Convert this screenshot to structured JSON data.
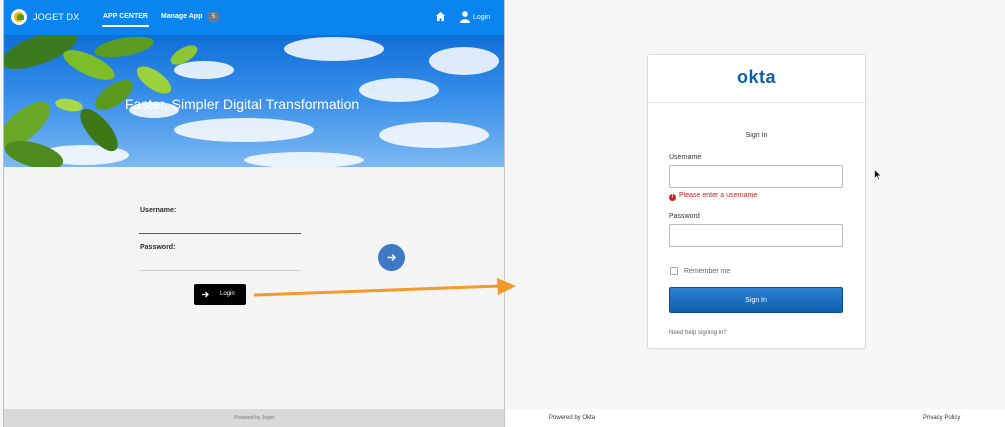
{
  "joget": {
    "brand": "JOGET DX",
    "nav": {
      "app_center": "APP CENTER",
      "manage_app": "Manage App",
      "manage_badge": "5",
      "login": "Login"
    },
    "banner_title": "Faster, Simpler Digital Transformation",
    "form": {
      "username_label": "Username:",
      "password_label": "Password:",
      "login_button": "Login"
    },
    "footer": "Powered by Joget"
  },
  "okta": {
    "logo": "okta",
    "title": "Sign In",
    "username_label": "Username",
    "username_error": "Please enter a username",
    "password_label": "Password",
    "remember_me": "Remember me",
    "sign_in_button": "Sign In",
    "help_link": "Need help signing in?",
    "footer": {
      "powered_by": "Powered by Okta",
      "privacy": "Privacy Policy"
    }
  },
  "colors": {
    "joget_blue": "#0a84ee",
    "okta_blue": "#0d5fa7",
    "error_red": "#cc2222",
    "arrow_orange": "#f39a2b"
  }
}
